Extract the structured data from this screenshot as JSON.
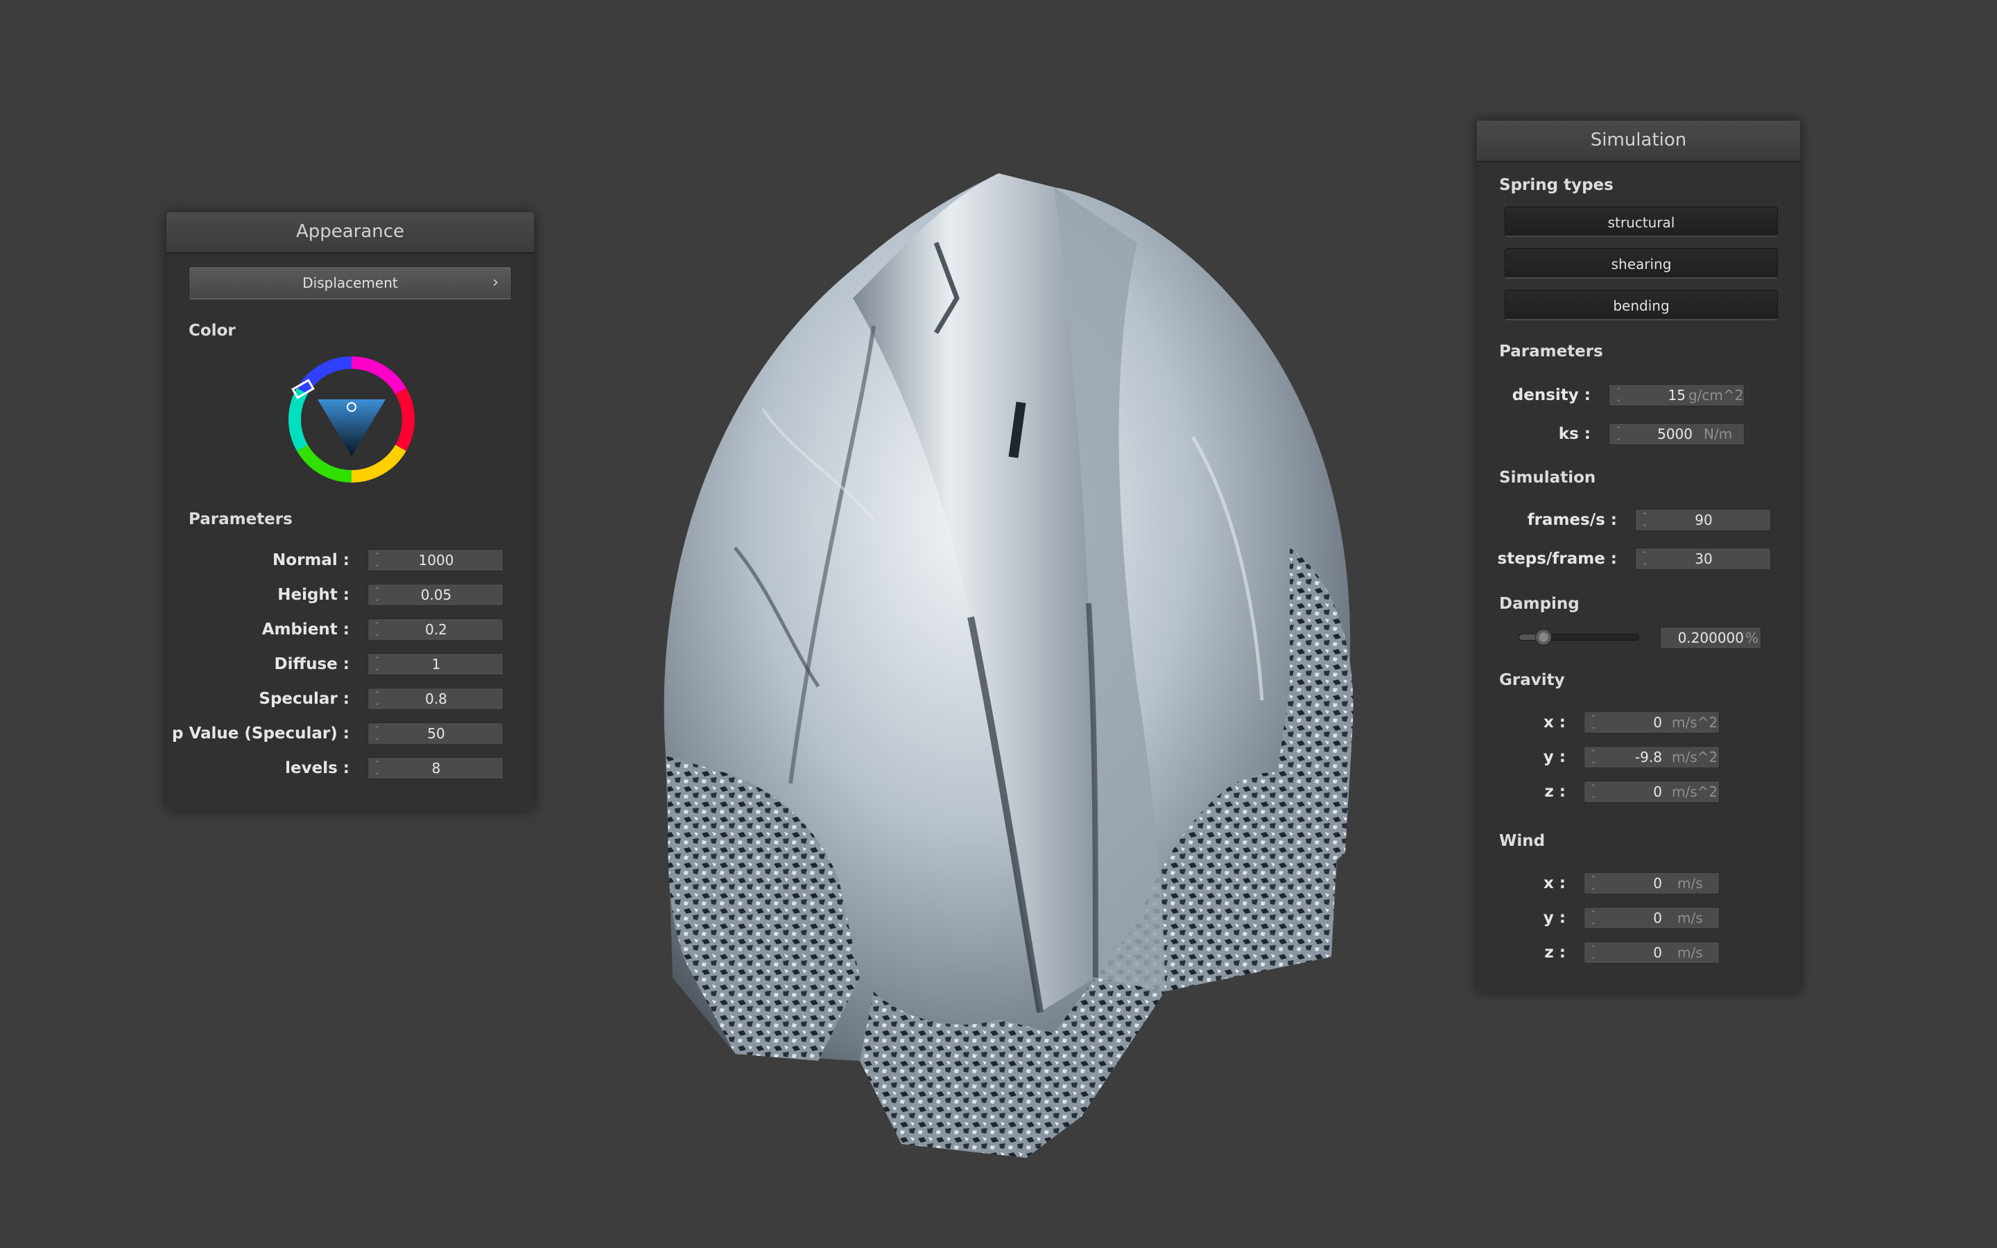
{
  "appearance": {
    "title": "Appearance",
    "mode_button": "Displacement",
    "color_label": "Color",
    "parameters_label": "Parameters",
    "params": [
      {
        "label": "Normal :",
        "value": "1000"
      },
      {
        "label": "Height :",
        "value": "0.05"
      },
      {
        "label": "Ambient :",
        "value": "0.2"
      },
      {
        "label": "Diffuse :",
        "value": "1"
      },
      {
        "label": "Specular :",
        "value": "0.8"
      },
      {
        "label": "p Value (Specular) :",
        "value": "50"
      },
      {
        "label": "levels :",
        "value": "8"
      }
    ]
  },
  "simulation": {
    "title": "Simulation",
    "spring_types_label": "Spring types",
    "spring_buttons": [
      "structural",
      "shearing",
      "bending"
    ],
    "parameters_label": "Parameters",
    "density": {
      "label": "density :",
      "value": "15",
      "unit": "g/cm^2"
    },
    "ks": {
      "label": "ks :",
      "value": "5000",
      "unit": "N/m"
    },
    "simulation_label": "Simulation",
    "frames": {
      "label": "frames/s :",
      "value": "90"
    },
    "steps": {
      "label": "steps/frame :",
      "value": "30"
    },
    "damping_label": "Damping",
    "damping": {
      "value": "0.200000",
      "unit": "%",
      "slider_fraction": 0.2
    },
    "gravity_label": "Gravity",
    "gravity": [
      {
        "label": "x :",
        "value": "0",
        "unit": "m/s^2"
      },
      {
        "label": "y :",
        "value": "-9.8",
        "unit": "m/s^2"
      },
      {
        "label": "z :",
        "value": "0",
        "unit": "m/s^2"
      }
    ],
    "wind_label": "Wind",
    "wind": [
      {
        "label": "x :",
        "value": "0",
        "unit": "m/s"
      },
      {
        "label": "y :",
        "value": "0",
        "unit": "m/s"
      },
      {
        "label": "z :",
        "value": "0",
        "unit": "m/s"
      }
    ]
  },
  "colors": {
    "background": "#3d3d3d",
    "panel": "#313131",
    "cloth": "#a9b4bf"
  }
}
